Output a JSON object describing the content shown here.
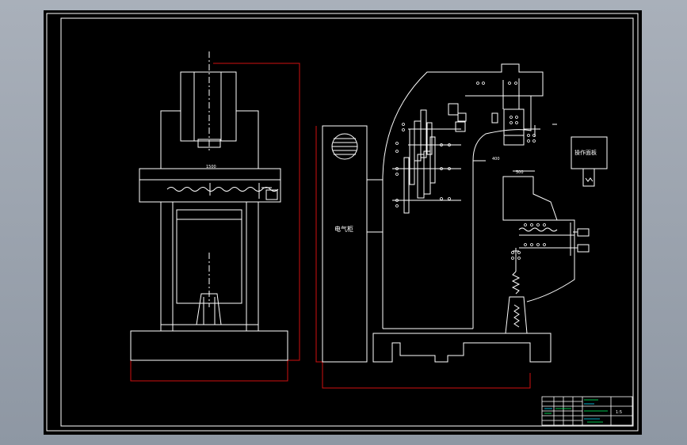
{
  "colors": {
    "background": "#000000",
    "viewport": "#a3aab4",
    "line": "#ffffff",
    "outline_red": "#d01010",
    "table_green": "#00ff66",
    "table_cyan": "#00e0ff"
  },
  "labels": {
    "electric_cabinet": "电气柜",
    "operation_panel": "操作面板",
    "front_dimension": "1500",
    "side_dimension": "500",
    "depth_dimension": "400"
  },
  "title_block": {
    "scale_mark": "1:5"
  }
}
